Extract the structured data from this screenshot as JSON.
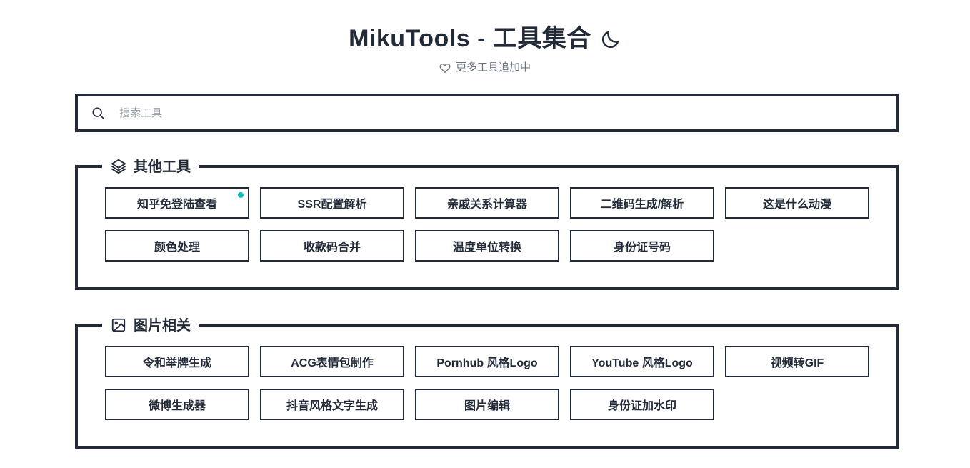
{
  "header": {
    "title": "MikuTools - 工具集合",
    "dark_mode_icon": "moon-icon",
    "subtitle": "更多工具追加中",
    "subtitle_icon": "heart-icon"
  },
  "search": {
    "icon": "search-icon",
    "value": "",
    "placeholder": "搜索工具"
  },
  "colors": {
    "border": "#232b38",
    "text": "#232b38",
    "muted": "#6b7280",
    "badge": "#10bcb8",
    "background": "#ffffff"
  },
  "sections": [
    {
      "icon": "layers-icon",
      "label": "其他工具",
      "rows": [
        [
          {
            "label": "知乎免登陆查看",
            "badge": true
          },
          {
            "label": "SSR配置解析",
            "badge": false
          },
          {
            "label": "亲戚关系计算器",
            "badge": false
          },
          {
            "label": "二维码生成/解析",
            "badge": false
          },
          {
            "label": "这是什么动漫",
            "badge": false
          }
        ],
        [
          {
            "label": "颜色处理",
            "badge": false
          },
          {
            "label": "收款码合并",
            "badge": false
          },
          {
            "label": "温度单位转换",
            "badge": false
          },
          {
            "label": "身份证号码",
            "badge": false
          }
        ]
      ]
    },
    {
      "icon": "image-icon",
      "label": "图片相关",
      "rows": [
        [
          {
            "label": "令和举牌生成",
            "badge": false
          },
          {
            "label": "ACG表情包制作",
            "badge": false
          },
          {
            "label": "Pornhub 风格Logo",
            "badge": false
          },
          {
            "label": "YouTube 风格Logo",
            "badge": false
          },
          {
            "label": "视频转GIF",
            "badge": false
          }
        ],
        [
          {
            "label": "微博生成器",
            "badge": false
          },
          {
            "label": "抖音风格文字生成",
            "badge": false
          },
          {
            "label": "图片编辑",
            "badge": false
          },
          {
            "label": "身份证加水印",
            "badge": false
          }
        ]
      ]
    }
  ]
}
